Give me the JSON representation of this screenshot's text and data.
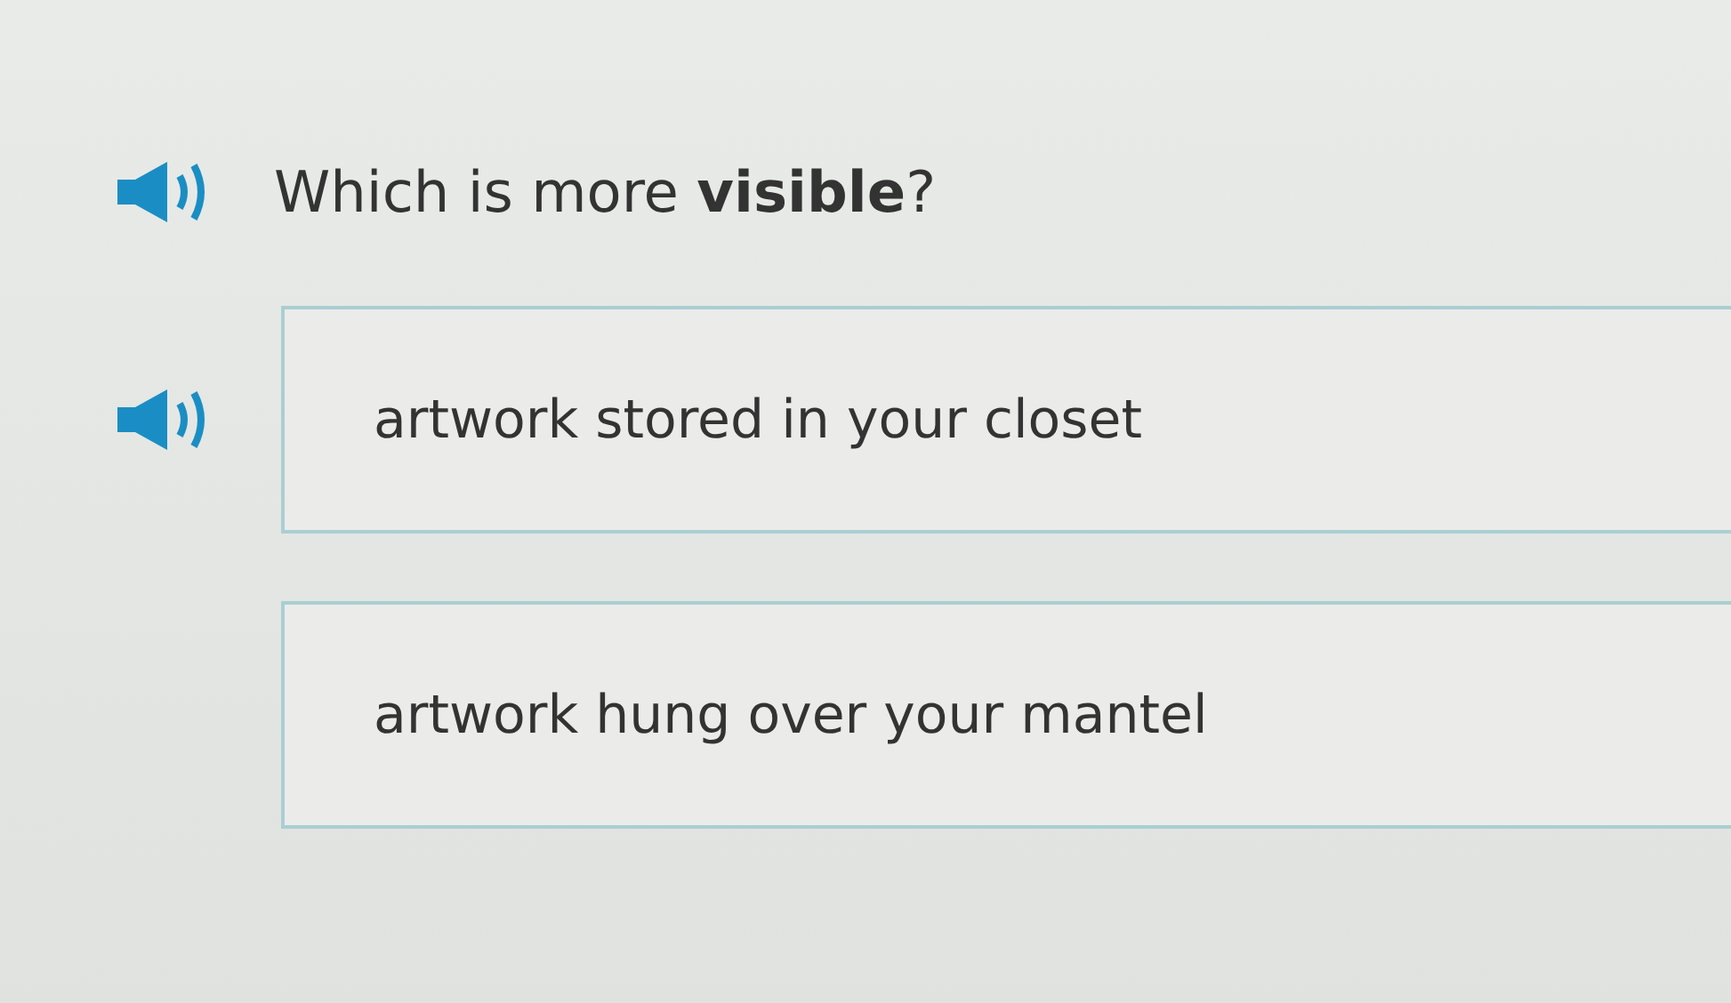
{
  "question": {
    "text": "Which is more **visible**?"
  },
  "options": [
    {
      "text": "artwork stored in your closet",
      "audio": true
    },
    {
      "text": "artwork hung over your mantel",
      "audio": false
    }
  ]
}
